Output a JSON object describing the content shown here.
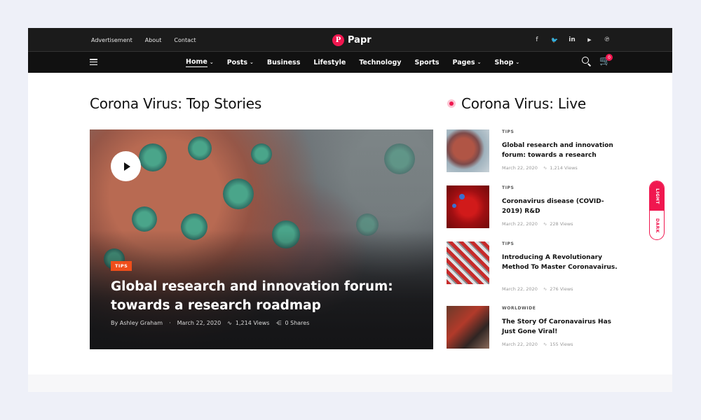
{
  "topbar": {
    "links": [
      "Advertisement",
      "About",
      "Contact"
    ],
    "logo": {
      "mark": "P",
      "name": "Papr"
    },
    "social": [
      {
        "icon": "facebook-icon",
        "glyph": "f"
      },
      {
        "icon": "twitter-icon",
        "glyph": "🐦"
      },
      {
        "icon": "linkedin-icon",
        "glyph": "in"
      },
      {
        "icon": "youtube-icon",
        "glyph": "▶"
      },
      {
        "icon": "pinterest-icon",
        "glyph": "℗"
      }
    ]
  },
  "nav": {
    "items": [
      {
        "label": "Home",
        "dropdown": true,
        "active": true
      },
      {
        "label": "Posts",
        "dropdown": true
      },
      {
        "label": "Business",
        "dropdown": false
      },
      {
        "label": "Lifestyle",
        "dropdown": false
      },
      {
        "label": "Technology",
        "dropdown": false
      },
      {
        "label": "Sports",
        "dropdown": false
      },
      {
        "label": "Pages",
        "dropdown": true
      },
      {
        "label": "Shop",
        "dropdown": true
      }
    ],
    "cart_count": "0"
  },
  "main": {
    "title": "Corona Virus: Top Stories",
    "feature": {
      "tag": "TIPS",
      "headline": "Global research and innovation forum: towards a research roadmap",
      "author": "By Ashley Graham",
      "date": "March 22, 2020",
      "views": "1,214 Views",
      "shares": "0 Shares"
    }
  },
  "live": {
    "title": "Corona Virus: Live",
    "cards": [
      {
        "category": "TIPS",
        "title": "Global research and innovation forum: towards a research",
        "date": "March 22, 2020",
        "views": "1,214 Views"
      },
      {
        "category": "TIPS",
        "title": "Coronavirus disease (COVID-2019) R&D",
        "date": "March 22, 2020",
        "views": "228 Views"
      },
      {
        "category": "TIPS",
        "title": "Introducing A Revolutionary Method To Master Coronavairus.",
        "date": "March 22, 2020",
        "views": "276 Views"
      },
      {
        "category": "WORLDWIDE",
        "title": "The Story Of Caronavairus Has Just Gone Viral!",
        "date": "March 22, 2020",
        "views": "155 Views"
      }
    ]
  },
  "theme_toggle": {
    "light": "LIGHT",
    "dark": "DARK"
  },
  "colors": {
    "accent": "#f0174f",
    "tag": "#f04e1a",
    "topbar": "#1b1b1b"
  }
}
